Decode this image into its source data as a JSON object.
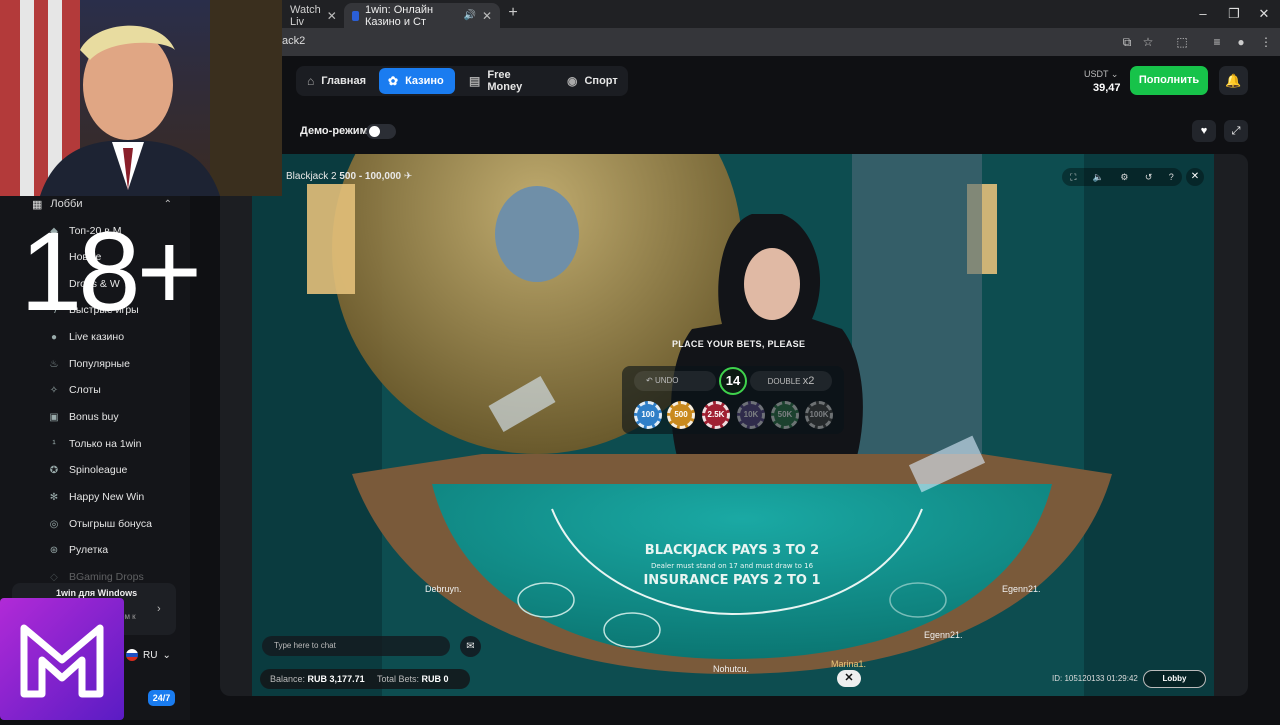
{
  "browser": {
    "tabs": [
      {
        "title": "Watch Liv",
        "close": "✕"
      },
      {
        "title": "1win: Онлайн Казино и Ст",
        "close": "✕"
      }
    ],
    "new_tab": "+",
    "url": "ack2",
    "window_controls": {
      "minimize": "–",
      "restore": "❐",
      "close": "✕"
    }
  },
  "header": {
    "nav": [
      {
        "label": "Главная",
        "icon": "home-icon"
      },
      {
        "label": "Казино",
        "icon": "casino-chip-icon"
      },
      {
        "label": "Free Money",
        "icon": "money-icon"
      },
      {
        "label": "Спорт",
        "icon": "ball-icon"
      }
    ],
    "currency": "USDT",
    "balance": "39,47",
    "deposit_label": "Пополнить"
  },
  "demo": {
    "label": "Демо-режим",
    "enabled": false
  },
  "sidebar": {
    "lobby_label": "Лобби",
    "items": [
      {
        "label": "Топ-20 в М"
      },
      {
        "label": "Новые"
      },
      {
        "label": "Drops & W"
      },
      {
        "label": "Быстрые игры"
      },
      {
        "label": "Live казино"
      },
      {
        "label": "Популярные"
      },
      {
        "label": "Слоты"
      },
      {
        "label": "Bonus buy"
      },
      {
        "label": "Только на 1win"
      },
      {
        "label": "Spinoleague"
      },
      {
        "label": "Happy New Win"
      },
      {
        "label": "Отыгрыш бонуса"
      },
      {
        "label": "Рулетка"
      },
      {
        "label": "BGaming Drops"
      }
    ],
    "win_app_title": "1win для Windows",
    "win_app_sub": "ом к",
    "language": "RU",
    "support": "24/7"
  },
  "overlay": {
    "rating": "18+"
  },
  "game": {
    "table_name": "Blackjack 2",
    "limits": "500 - 100,000",
    "prompt": "PLACE YOUR BETS, PLEASE",
    "undo_label": "UNDO",
    "double_label": "DOUBLE",
    "double_mult": "x2",
    "timer": "14",
    "chips": [
      {
        "label": "100",
        "color": "#2f7fc8"
      },
      {
        "label": "500",
        "color": "#c9891d"
      },
      {
        "label": "2.5K",
        "color": "#a02032"
      },
      {
        "label": "10K",
        "color": "#5a4a8a"
      },
      {
        "label": "50K",
        "color": "#2f7a4a"
      },
      {
        "label": "100K",
        "color": "#444444"
      }
    ],
    "table_text": [
      "BLACKJACK PAYS 3 TO 2",
      "Dealer must stand on 17 and must draw to 16",
      "INSURANCE PAYS 2 TO 1"
    ],
    "seats": [
      "Debruyn.",
      "Nohutcu.",
      "Marina1.",
      "Egenn21.",
      "Egenn21."
    ],
    "chat_placeholder": "Type here to chat",
    "balance_label": "Balance:",
    "balance_value": "RUB 3,177.71",
    "total_bets_label": "Total Bets:",
    "total_bets_value": "RUB 0",
    "round_id": "ID: 105120133  01:29:42",
    "lobby_button": "Lobby"
  }
}
